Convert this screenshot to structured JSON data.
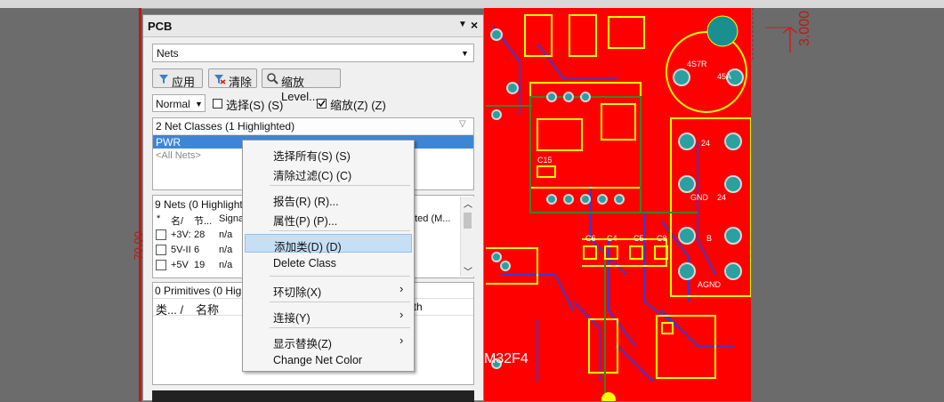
{
  "panel": {
    "title": "PCB",
    "nets_select": "Nets",
    "apply_label": "应用",
    "clear_label": "清除",
    "zoom_level_label": "缩放Level...",
    "mode_select": "Normal",
    "select_checkbox_label": "选择(S) (S)",
    "select_checked": false,
    "zoom_checkbox_label": "缩放(Z) (Z)",
    "zoom_checked": true
  },
  "classes": {
    "header": "2 Net Classes (1 Highlighted)",
    "items": [
      "PWR",
      "<All Nets>"
    ]
  },
  "nets": {
    "header": "9 Nets (0 Highlight",
    "columns": [
      "*",
      "名/",
      "节...",
      "Signa",
      "uted (M..."
    ],
    "rows": [
      {
        "name": "+3V:",
        "nodes": "28",
        "signal": "n/a"
      },
      {
        "name": "5V-II",
        "nodes": "6",
        "signal": "n/a"
      },
      {
        "name": "+5V",
        "nodes": "19",
        "signal": "n/a"
      }
    ]
  },
  "primitives": {
    "header": "0 Primitives (0 High",
    "columns": [
      "类... /",
      "名称",
      "gth"
    ]
  },
  "context_menu": {
    "items": [
      {
        "label": "选择所有(S) (S)",
        "submenu": false
      },
      {
        "label": "清除过滤(C) (C)",
        "submenu": false
      },
      {
        "label": "报告(R) (R)...",
        "submenu": false
      },
      {
        "label": "属性(P) (P)...",
        "submenu": false
      },
      {
        "label": "添加类(D) (D)",
        "submenu": false,
        "highlighted": true
      },
      {
        "label": "Delete Class",
        "submenu": false
      },
      {
        "label": "环切除(X)",
        "submenu": true
      },
      {
        "label": "连接(Y)",
        "submenu": true
      },
      {
        "label": "显示替换(Z)",
        "submenu": true
      },
      {
        "label": "Change Net Color",
        "submenu": false
      }
    ]
  },
  "pcb": {
    "board_color": "#ff0000",
    "trace_color": "#3a3ad0",
    "outline_color": "#ffff00",
    "silk_text": [
      "M32F4",
      "3.000",
      "70.00"
    ],
    "pad_labels": [
      "24",
      "GND",
      "24",
      "B",
      "AGND",
      "4S7R",
      "45A",
      "C6",
      "C4",
      "C5",
      "C8",
      "C15"
    ]
  }
}
